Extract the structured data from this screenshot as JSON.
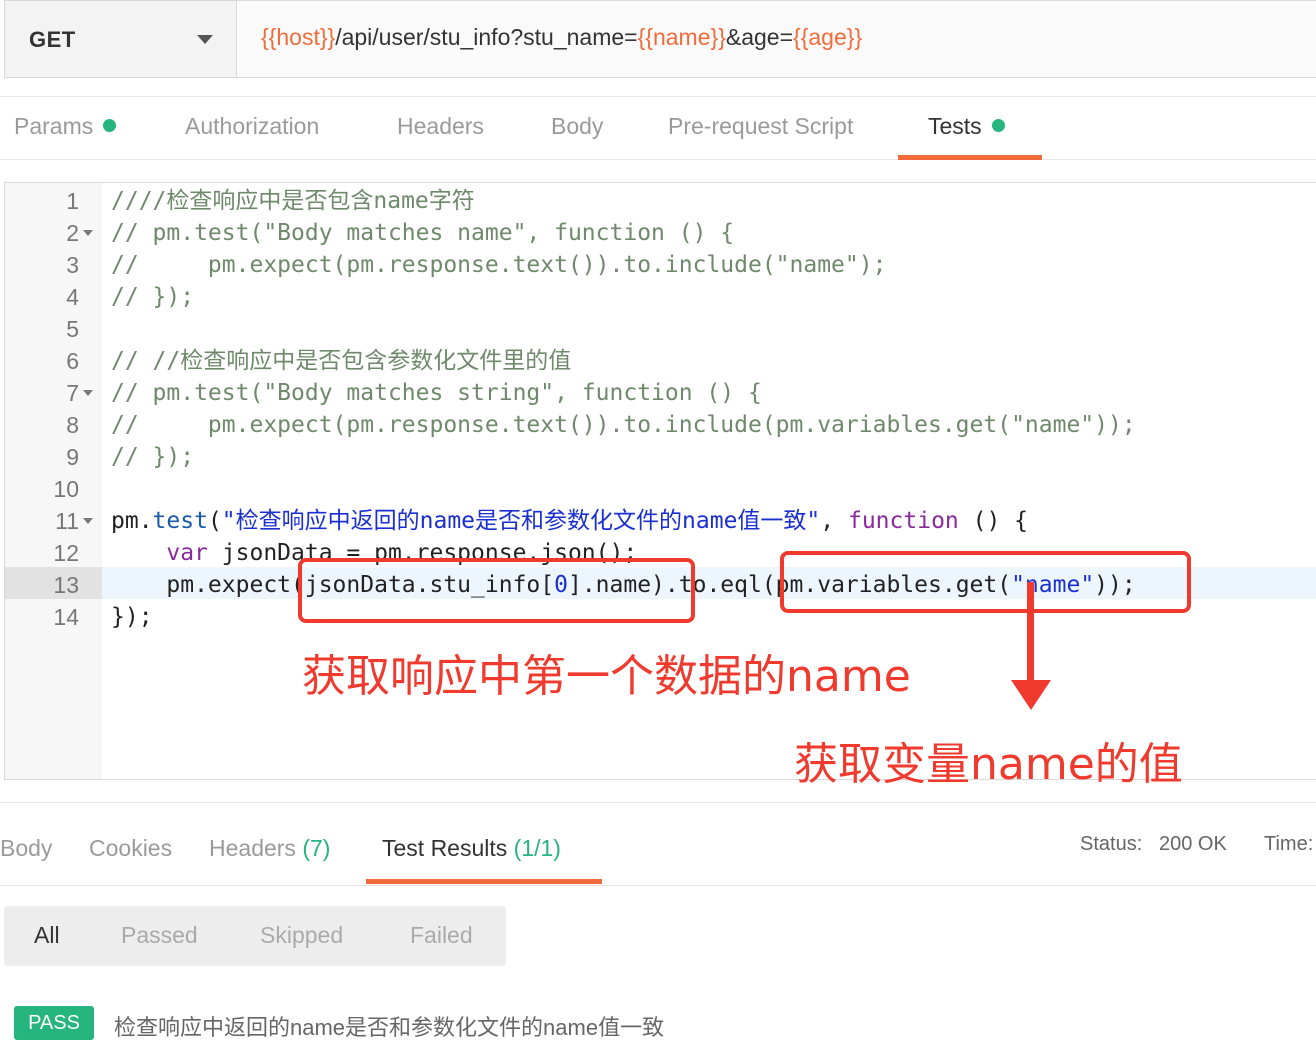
{
  "request": {
    "method": "GET",
    "url_parts": [
      {
        "text": "{{host}}",
        "var": true
      },
      {
        "text": "/api/user/stu_info?stu_name=",
        "var": false
      },
      {
        "text": "{{name}}",
        "var": true
      },
      {
        "text": "&age=",
        "var": false
      },
      {
        "text": "{{age}}",
        "var": true
      }
    ]
  },
  "request_tabs": [
    {
      "label": "Params",
      "dot": true,
      "active": false
    },
    {
      "label": "Authorization",
      "dot": false,
      "active": false
    },
    {
      "label": "Headers",
      "dot": false,
      "active": false
    },
    {
      "label": "Body",
      "dot": false,
      "active": false
    },
    {
      "label": "Pre-request Script",
      "dot": false,
      "active": false
    },
    {
      "label": "Tests",
      "dot": true,
      "active": true
    }
  ],
  "editor": {
    "lines": [
      {
        "n": "1",
        "fold": false,
        "segs": [
          [
            "c",
            "////检查响应中是否包含name字符"
          ]
        ]
      },
      {
        "n": "2",
        "fold": true,
        "segs": [
          [
            "c",
            "// pm.test(\"Body matches name\", function () {"
          ]
        ]
      },
      {
        "n": "3",
        "fold": false,
        "segs": [
          [
            "c",
            "//     pm.expect(pm.response.text()).to.include(\"name\");"
          ]
        ]
      },
      {
        "n": "4",
        "fold": false,
        "segs": [
          [
            "c",
            "// });"
          ]
        ]
      },
      {
        "n": "5",
        "fold": false,
        "segs": []
      },
      {
        "n": "6",
        "fold": false,
        "segs": [
          [
            "c",
            "// //检查响应中是否包含参数化文件里的值"
          ]
        ]
      },
      {
        "n": "7",
        "fold": true,
        "segs": [
          [
            "c",
            "// pm.test(\"Body matches string\", function () {"
          ]
        ]
      },
      {
        "n": "8",
        "fold": false,
        "segs": [
          [
            "c",
            "//     pm.expect(pm.response.text()).to.include(pm.variables.get(\"name\"));"
          ]
        ]
      },
      {
        "n": "9",
        "fold": false,
        "segs": [
          [
            "c",
            "// });"
          ]
        ]
      },
      {
        "n": "10",
        "fold": false,
        "segs": []
      },
      {
        "n": "11",
        "fold": true,
        "segs": [
          [
            "p",
            "pm."
          ],
          [
            "fn",
            "test"
          ],
          [
            "p",
            "("
          ],
          [
            "s",
            "\"检查响应中返回的name是否和参数化文件的name值一致\""
          ],
          [
            "p",
            ", "
          ],
          [
            "kw",
            "function"
          ],
          [
            "p",
            " () {"
          ]
        ]
      },
      {
        "n": "12",
        "fold": false,
        "segs": [
          [
            "p",
            "    "
          ],
          [
            "kw",
            "var"
          ],
          [
            "p",
            " jsonData = pm.response.json();"
          ]
        ]
      },
      {
        "n": "13",
        "fold": false,
        "segs": [
          [
            "p",
            "    pm.expect(jsonData.stu_info["
          ],
          [
            "s",
            "0"
          ],
          [
            "p",
            "].name).to.eql(pm.variables.get("
          ],
          [
            "s",
            "\"name\""
          ],
          [
            "p",
            "));"
          ]
        ]
      },
      {
        "n": "14",
        "fold": false,
        "segs": [
          [
            "p",
            "});"
          ]
        ]
      }
    ]
  },
  "annotations": {
    "first_item_name": "获取响应中第一个数据的name",
    "variable_name_value": "获取变量name的值"
  },
  "response_tabs": [
    {
      "label": "Body",
      "count": "",
      "active": false
    },
    {
      "label": "Cookies",
      "count": "",
      "active": false
    },
    {
      "label": "Headers",
      "count": "(7)",
      "active": false
    },
    {
      "label": "Test Results",
      "count": "(1/1)",
      "active": true
    }
  ],
  "status": {
    "label": "Status:",
    "value": "200 OK",
    "time_label": "Time:"
  },
  "filters": [
    {
      "label": "All",
      "active": true
    },
    {
      "label": "Passed",
      "active": false
    },
    {
      "label": "Skipped",
      "active": false
    },
    {
      "label": "Failed",
      "active": false
    }
  ],
  "result": {
    "badge": "PASS",
    "text": "检查响应中返回的name是否和参数化文件的name值一致"
  },
  "colors": {
    "accent": "#f26b3a",
    "success": "#26b47f",
    "annotation": "#f03a2e"
  }
}
